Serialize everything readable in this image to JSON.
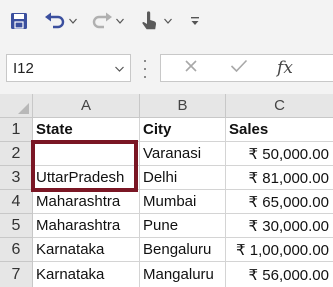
{
  "toolbar": {
    "items": [
      {
        "name": "save-icon"
      },
      {
        "name": "undo-icon"
      },
      {
        "name": "redo-icon"
      },
      {
        "name": "touch-mode-icon"
      },
      {
        "name": "customize-toolbar-icon"
      }
    ],
    "accent": "#217346"
  },
  "formula_bar": {
    "name_box": "I12",
    "formula": "",
    "cancel_icon": "close-icon",
    "enter_icon": "check-icon",
    "insert_function_label": "fx"
  },
  "sheet": {
    "columns": [
      "A",
      "B",
      "C"
    ],
    "rows": [
      "1",
      "2",
      "3",
      "4",
      "5",
      "6",
      "7"
    ],
    "header": [
      "State",
      "City",
      "Sales"
    ],
    "data": [
      [
        "",
        "Varanasi",
        "₹ 50,000.00"
      ],
      [
        "UttarPradesh",
        "Delhi",
        "₹ 81,000.00"
      ],
      [
        "Maharashtra",
        "Mumbai",
        "₹ 65,000.00"
      ],
      [
        "Maharashtra",
        "Pune",
        "₹ 30,000.00"
      ],
      [
        "Karnataka",
        "Bengaluru",
        "₹ 1,00,000.00"
      ],
      [
        "Karnataka",
        "Mangaluru",
        "₹ 56,000.00"
      ]
    ],
    "selection_color": "#7a1624",
    "selection_range": "A2:A3"
  }
}
